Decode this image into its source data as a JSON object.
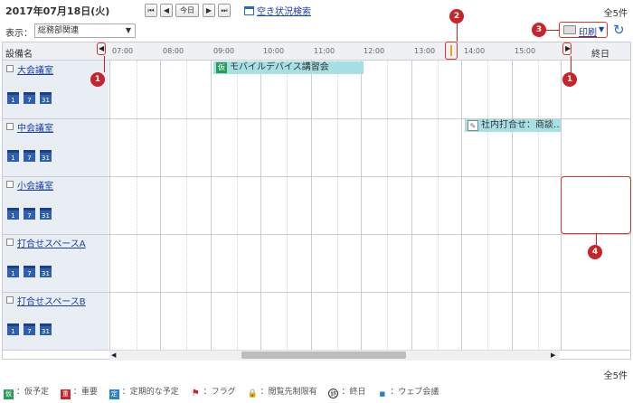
{
  "header": {
    "date": "2017年07月18日(火)",
    "nav": [
      "⏮",
      "◀",
      "今日",
      "▶",
      "⏭"
    ],
    "vacancy_search": "空き状況検索",
    "total": "全5件"
  },
  "filter": {
    "label": "表示：",
    "selected": "総務部関連"
  },
  "toolbar": {
    "print_label": "印刷"
  },
  "grid": {
    "facility_header": "設備名",
    "allday_header": "終日",
    "hours": [
      "07:00",
      "08:00",
      "09:00",
      "10:00",
      "11:00",
      "12:00",
      "13:00",
      "14:00",
      "15:00"
    ],
    "facilities": [
      {
        "name": "大会議室",
        "mini_cals": [
          "1",
          "7",
          "31"
        ]
      },
      {
        "name": "中会議室",
        "mini_cals": [
          "1",
          "7",
          "31"
        ]
      },
      {
        "name": "小会議室",
        "mini_cals": [
          "1",
          "7",
          "31"
        ]
      },
      {
        "name": "打合せスペースA",
        "mini_cals": [
          "1",
          "7",
          "31"
        ]
      },
      {
        "name": "打合せスペースB",
        "mini_cals": [
          "1",
          "7",
          "31"
        ]
      }
    ],
    "events": [
      {
        "tag": "仮",
        "title": "モバイルデバイス講習会"
      },
      {
        "tag": "✎",
        "title": "社内打合せ：商談…"
      }
    ]
  },
  "callouts": [
    "1",
    "2",
    "3",
    "1",
    "4"
  ],
  "footer": {
    "total": "全5件",
    "legend": [
      {
        "icon": "仮",
        "label": "：仮予定",
        "color": "#2a9c5c"
      },
      {
        "icon": "重",
        "label": "：重要",
        "color": "#c9232b"
      },
      {
        "icon": "定",
        "label": "：定期的な予定",
        "color": "#2a80d0"
      },
      {
        "icon": "⚑",
        "label": "：フラグ",
        "color": "#c9232b"
      },
      {
        "icon": "🔒",
        "label": "：閲覧先制限有",
        "color": "#e0b000"
      },
      {
        "icon": "終",
        "label": "：終日",
        "color": "#333333"
      },
      {
        "icon": "■",
        "label": "：ウェブ会議",
        "color": "#2a80d0"
      }
    ]
  }
}
